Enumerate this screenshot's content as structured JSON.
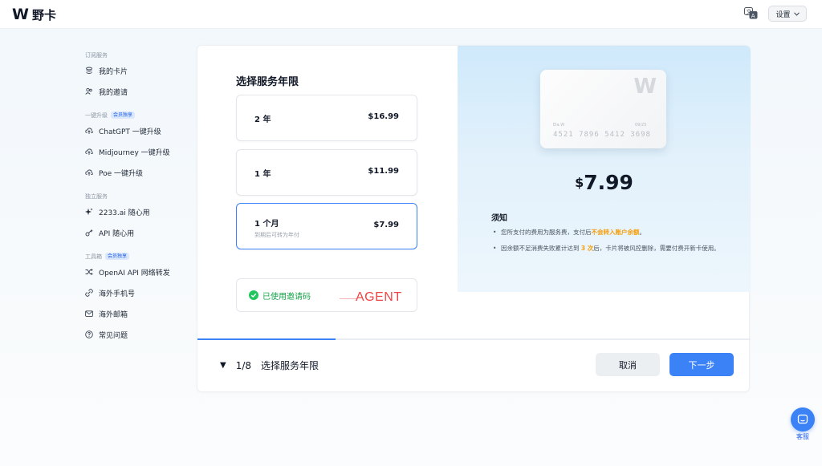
{
  "header": {
    "logo_mark": "W",
    "app_name": "野卡",
    "settings_label": "设置"
  },
  "sidebar": {
    "groups": [
      {
        "title": "订阅服务",
        "badge": "",
        "items": [
          {
            "label": "我的卡片",
            "icon": "cards-icon"
          },
          {
            "label": "我的邀请",
            "icon": "users-icon"
          }
        ]
      },
      {
        "title": "一键升级",
        "badge": "会员独享",
        "items": [
          {
            "label": "ChatGPT 一键升级",
            "icon": "cloud-upload-icon"
          },
          {
            "label": "Midjourney 一键升级",
            "icon": "cloud-upload-icon"
          },
          {
            "label": "Poe 一键升级",
            "icon": "cloud-upload-icon"
          }
        ]
      },
      {
        "title": "独立服务",
        "badge": "",
        "items": [
          {
            "label": "2233.ai 随心用",
            "icon": "sparkle-icon"
          },
          {
            "label": "API 随心用",
            "icon": "key-icon"
          }
        ]
      },
      {
        "title": "工具箱",
        "badge": "会员独享",
        "items": [
          {
            "label": "OpenAI API 网络转发",
            "icon": "shuffle-icon"
          },
          {
            "label": "海外手机号",
            "icon": "phone-icon"
          },
          {
            "label": "海外邮箱",
            "icon": "mail-icon"
          },
          {
            "label": "常见问题",
            "icon": "help-icon"
          }
        ]
      }
    ]
  },
  "wizard": {
    "title": "选择服务年限",
    "options": [
      {
        "name": "2 年",
        "sub": "",
        "price": "$16.99",
        "selected": false
      },
      {
        "name": "1 年",
        "sub": "",
        "price": "$11.99",
        "selected": false
      },
      {
        "name": "1 个月",
        "sub": "到期后可转为年付",
        "price": "$7.99",
        "selected": true
      }
    ],
    "invite_status": "已使用邀请码",
    "agent_tag": "AGENT"
  },
  "preview": {
    "card_logo": "W",
    "card_holder": "Ela.W",
    "card_expiry": "09/25",
    "card_number": "4521 7896 5412 3698",
    "price_currency": "$",
    "price_value": "7.99",
    "notice_title": "须知",
    "notice1_pre": "您所支付的费用为服务费，支付后",
    "notice1_hl": "不会转入账户余额",
    "notice1_post": "。",
    "notice2_pre": "因余额不足消费失败累计达到 ",
    "notice2_hl": "3 次",
    "notice2_post": "后，卡片将被风控删除，需要付费开新卡使用。"
  },
  "footer": {
    "step_progress": "1/8",
    "progress_fraction": 0.125,
    "step_title": "选择服务年限",
    "cancel_label": "取消",
    "next_label": "下一步"
  },
  "support": {
    "label": "客服"
  },
  "colors": {
    "accent": "#3b82f6",
    "success": "#16a34a",
    "highlight": "#f59e0b",
    "agent": "#ef4444"
  }
}
